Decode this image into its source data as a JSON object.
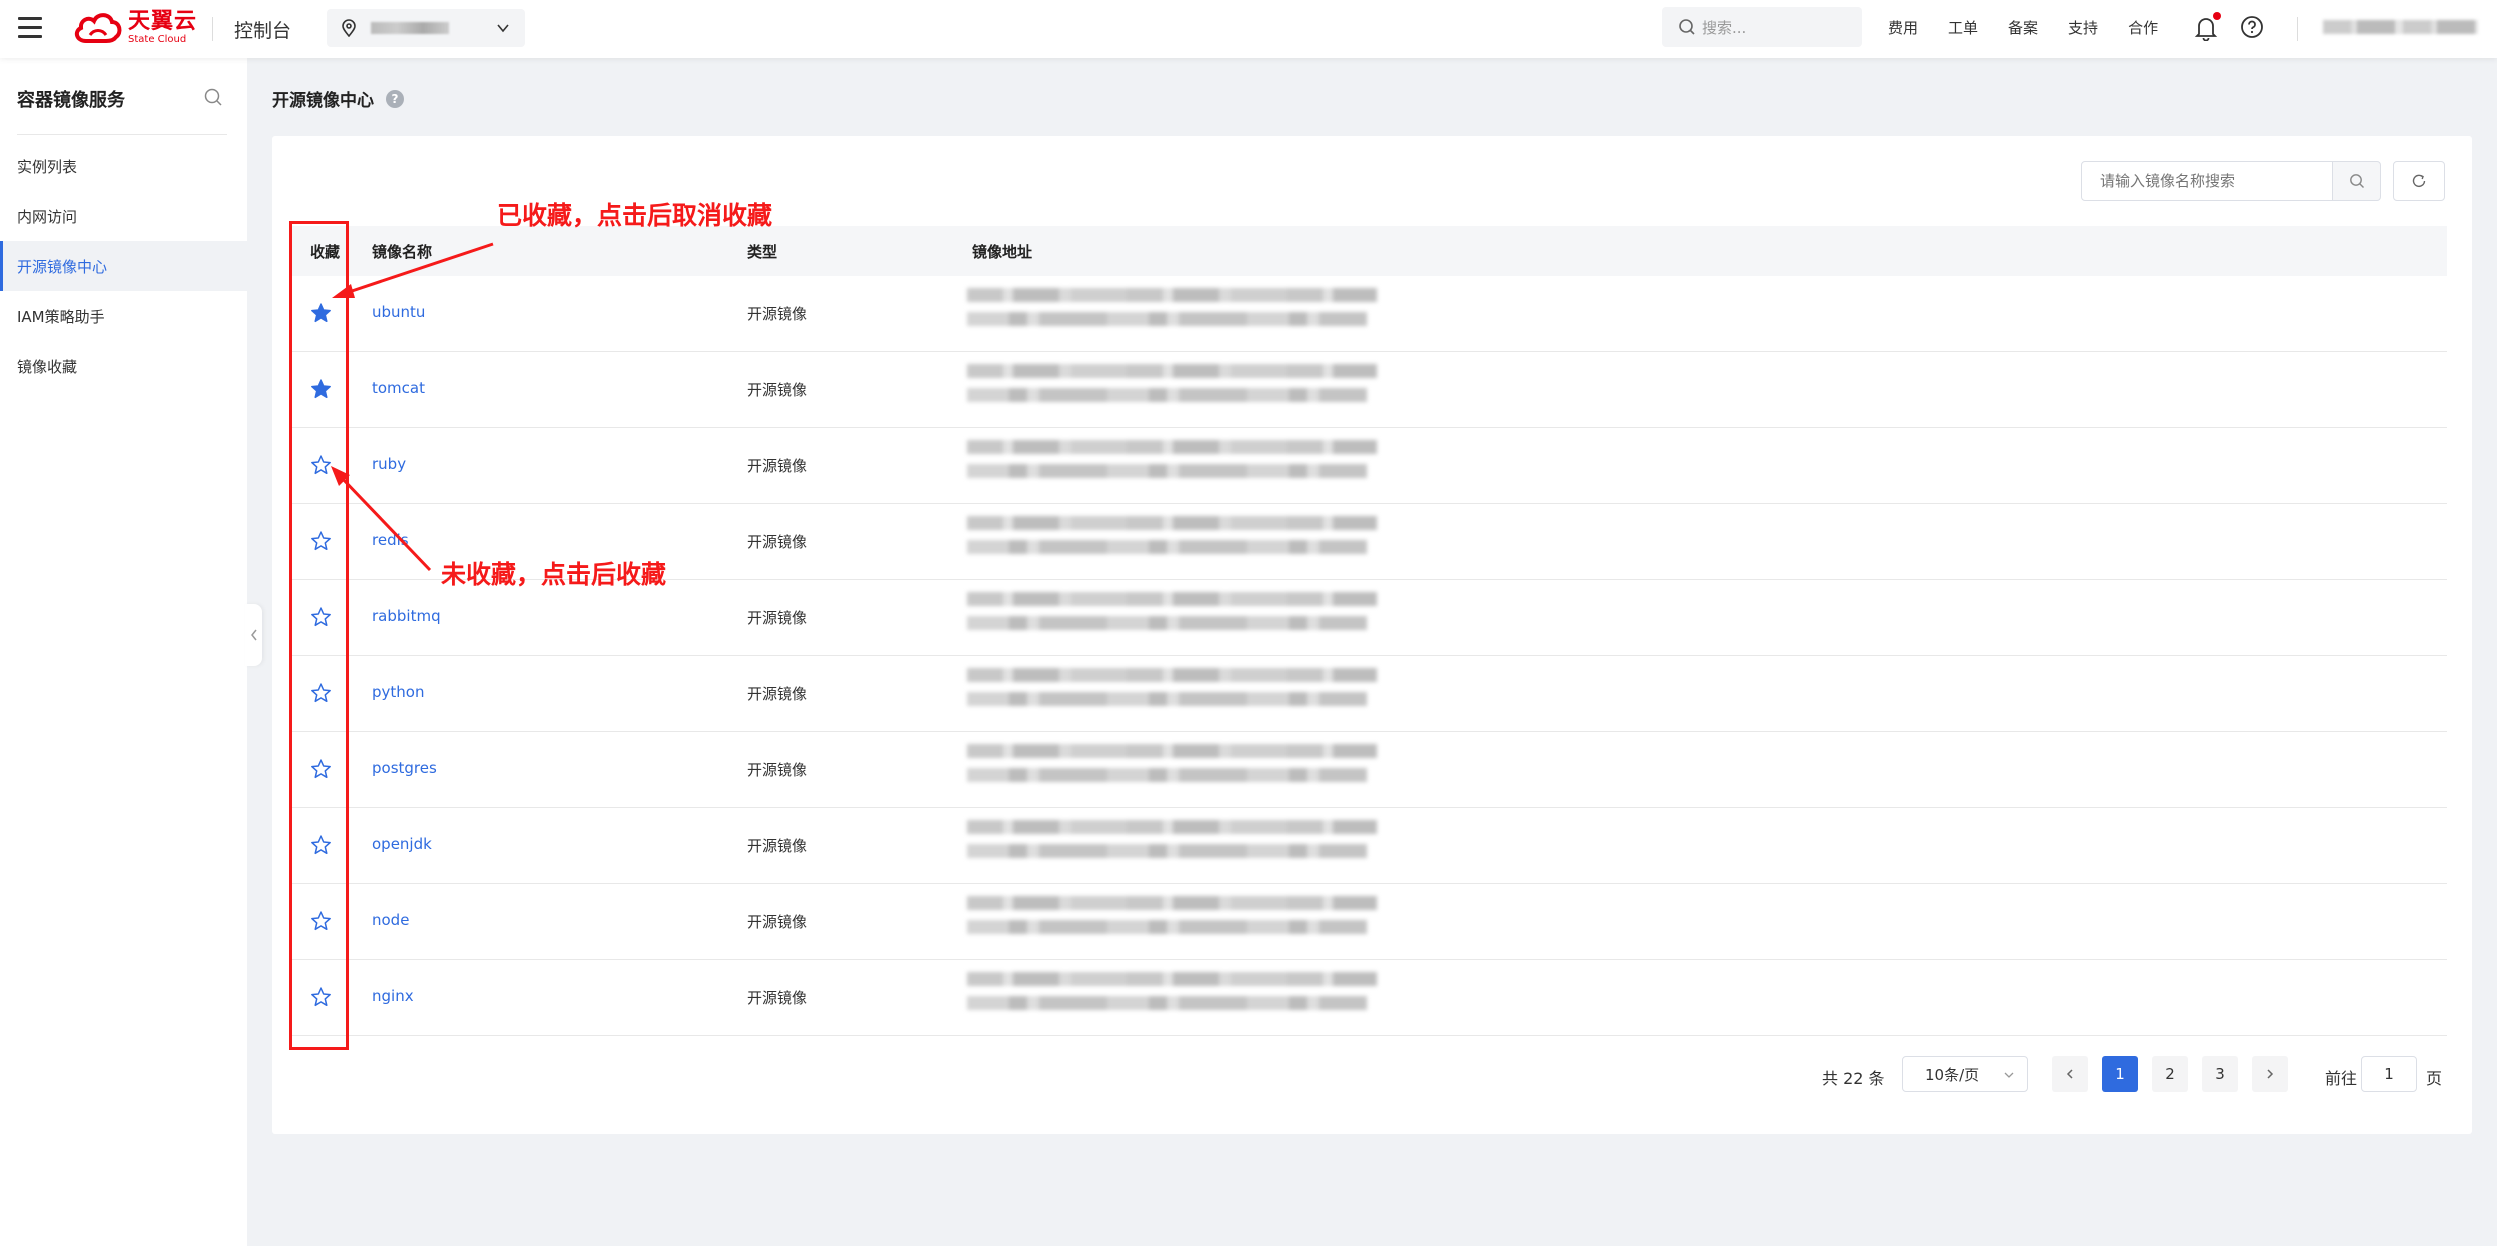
{
  "topbar": {
    "logo_cn": "天翼云",
    "logo_en": "State Cloud",
    "console": "控制台",
    "search_placeholder": "搜索...",
    "links": [
      "费用",
      "工单",
      "备案",
      "支持",
      "合作"
    ]
  },
  "sidebar": {
    "title": "容器镜像服务",
    "items": [
      {
        "label": "实例列表"
      },
      {
        "label": "内网访问"
      },
      {
        "label": "开源镜像中心"
      },
      {
        "label": "IAM策略助手"
      },
      {
        "label": "镜像收藏"
      }
    ]
  },
  "main": {
    "title": "开源镜像中心",
    "help": "?",
    "search_placeholder": "请输入镜像名称搜索",
    "columns": {
      "fav": "收藏",
      "name": "镜像名称",
      "type": "类型",
      "addr": "镜像地址"
    },
    "rows": [
      {
        "name": "ubuntu",
        "type": "开源镜像",
        "favorited": true
      },
      {
        "name": "tomcat",
        "type": "开源镜像",
        "favorited": true
      },
      {
        "name": "ruby",
        "type": "开源镜像",
        "favorited": false
      },
      {
        "name": "redis",
        "type": "开源镜像",
        "favorited": false
      },
      {
        "name": "rabbitmq",
        "type": "开源镜像",
        "favorited": false
      },
      {
        "name": "python",
        "type": "开源镜像",
        "favorited": false
      },
      {
        "name": "postgres",
        "type": "开源镜像",
        "favorited": false
      },
      {
        "name": "openjdk",
        "type": "开源镜像",
        "favorited": false
      },
      {
        "name": "node",
        "type": "开源镜像",
        "favorited": false
      },
      {
        "name": "nginx",
        "type": "开源镜像",
        "favorited": false
      }
    ],
    "pagination": {
      "total": "共 22 条",
      "page_size": "10条/页",
      "pages": [
        "1",
        "2",
        "3"
      ],
      "current": "1",
      "goto_label": "前往",
      "goto_value": "1",
      "goto_unit": "页"
    }
  },
  "annotations": {
    "favorited": "已收藏，点击后取消收藏",
    "not_favorited": "未收藏，点击后收藏",
    "color": "#f51a1a"
  },
  "colors": {
    "accent": "#2f6bdf",
    "brand": "#e60012"
  }
}
